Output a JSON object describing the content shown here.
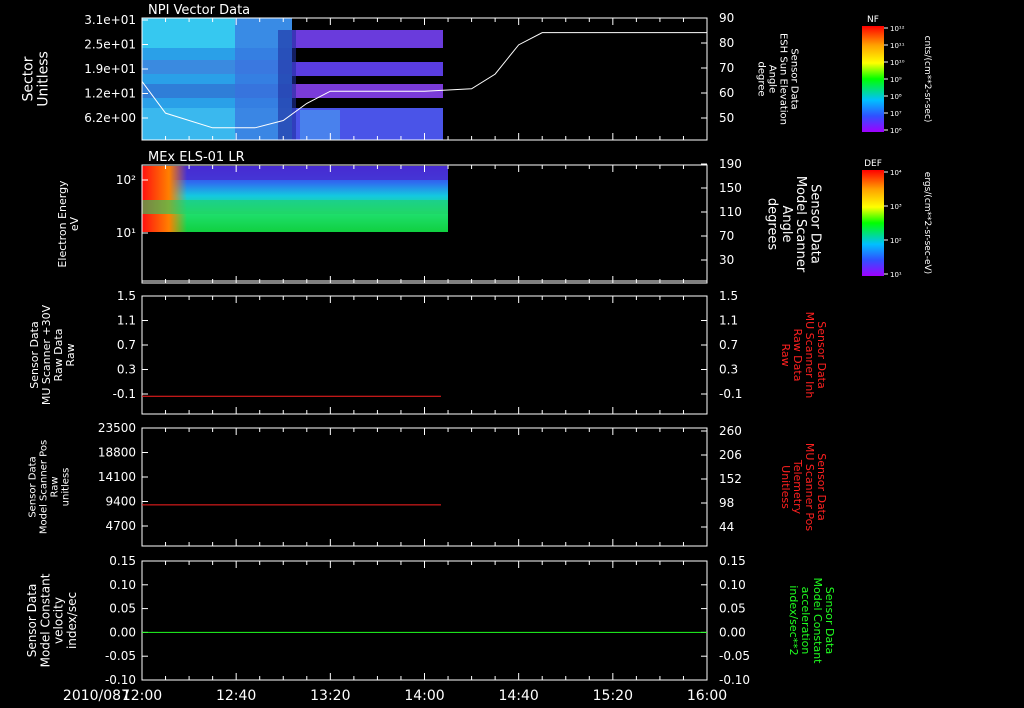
{
  "date": "2010/087",
  "time_ticks": [
    "12:00",
    "12:40",
    "13:20",
    "14:00",
    "14:40",
    "15:20",
    "16:00"
  ],
  "chart_data": [
    {
      "type": "heatmap",
      "title": "NPI Vector Data",
      "ylabel_lines": [
        "Sector",
        "Unitless"
      ],
      "yticks": [
        "3.1e+01",
        "2.5e+01",
        "1.9e+01",
        "1.2e+01",
        "6.2e+00"
      ],
      "y2label_lines": [
        "Sensor Data",
        "ESH Sun Elevation",
        "Angle",
        "degree"
      ],
      "y2ticks": [
        "90",
        "80",
        "70",
        "60",
        "50"
      ],
      "y2lim": [
        40,
        90
      ],
      "data_end": "14:07",
      "line": {
        "x": [
          "12:00",
          "12:10",
          "12:30",
          "12:48",
          "13:00",
          "13:10",
          "13:20",
          "14:00",
          "14:20",
          "14:30",
          "14:40",
          "14:50",
          "15:20",
          "16:00"
        ],
        "y": [
          64,
          51,
          45,
          45,
          48,
          55,
          60,
          60,
          61,
          67,
          79,
          84,
          84,
          84
        ]
      },
      "colorbar": {
        "label": "NF",
        "unit": "cnts/(cm**2-sr-sec)",
        "ticks": [
          "10¹²",
          "10¹¹",
          "10¹⁰",
          "10⁹",
          "10⁸",
          "10⁷",
          "10⁶"
        ]
      }
    },
    {
      "type": "heatmap",
      "title": "MEx ELS-01 LR",
      "ylabel_lines": [
        "Electron Energy",
        "eV"
      ],
      "yticks": [
        "10²",
        "10¹"
      ],
      "y2label_lines": [
        "Sensor Data",
        "Model Scanner",
        "Angle",
        "degrees"
      ],
      "y2ticks": [
        "190",
        "150",
        "110",
        "70",
        "30"
      ],
      "y2lim": [
        10,
        190
      ],
      "data_end": "14:07",
      "line": {
        "x": [
          "12:00",
          "16:00"
        ],
        "y": [
          13,
          13
        ]
      },
      "colorbar": {
        "label": "DEF",
        "unit": "ergs/(cm**2-sr-sec-eV)",
        "ticks": [
          "10⁴",
          "10³",
          "10²",
          "10¹"
        ]
      }
    },
    {
      "type": "line",
      "ylabel_lines": [
        "Sensor Data",
        "MU Scanner +30V",
        "Raw Data",
        "Raw"
      ],
      "yticks": [
        "1.5",
        "1.1",
        "0.7",
        "0.3",
        "-0.1"
      ],
      "ylim": [
        -0.3,
        1.5
      ],
      "y2label_lines": [
        "Sensor Data",
        "MU Scanner Inh",
        "Raw Data",
        "Raw"
      ],
      "y2ticks": [
        "1.5",
        "1.1",
        "0.7",
        "0.3",
        "-0.1"
      ],
      "series": [
        {
          "x": [
            "12:00",
            "14:07"
          ],
          "y": [
            -0.03,
            -0.03
          ],
          "color": "#ff2020"
        }
      ]
    },
    {
      "type": "line",
      "ylabel_lines": [
        "Sensor Data",
        "Model Scanner Pos",
        "Raw",
        "unitless"
      ],
      "yticks": [
        "23500",
        "18800",
        "14100",
        "9400",
        "4700"
      ],
      "ylim": [
        0,
        23500
      ],
      "y2label_lines": [
        "Sensor Data",
        "MU Scanner Pos",
        "Telemetry",
        "Unitless"
      ],
      "y2ticks": [
        "260",
        "206",
        "152",
        "98",
        "44"
      ],
      "series": [
        {
          "x": [
            "12:00",
            "14:07"
          ],
          "y": [
            8200,
            8200
          ],
          "color": "#ff2020"
        }
      ]
    },
    {
      "type": "line",
      "ylabel_lines": [
        "Sensor Data",
        "Model Constant",
        "velocity",
        "index/sec"
      ],
      "yticks": [
        "0.15",
        "0.10",
        "0.05",
        "0.00",
        "-0.05",
        "-0.10"
      ],
      "ylim": [
        -0.1,
        0.15
      ],
      "y2label_lines": [
        "Sensor Data",
        "Model Constant",
        "acceleration",
        "index/sec**2"
      ],
      "y2ticks": [
        "0.15",
        "0.10",
        "0.05",
        "0.00",
        "-0.05",
        "-0.10"
      ],
      "series": [
        {
          "x": [
            "12:00",
            "16:00"
          ],
          "y": [
            0,
            0
          ],
          "color": "#20ff20"
        }
      ]
    }
  ],
  "colors": {
    "red_label": "#ff2020",
    "green_label": "#20ff20",
    "axis": "#ffffff"
  }
}
